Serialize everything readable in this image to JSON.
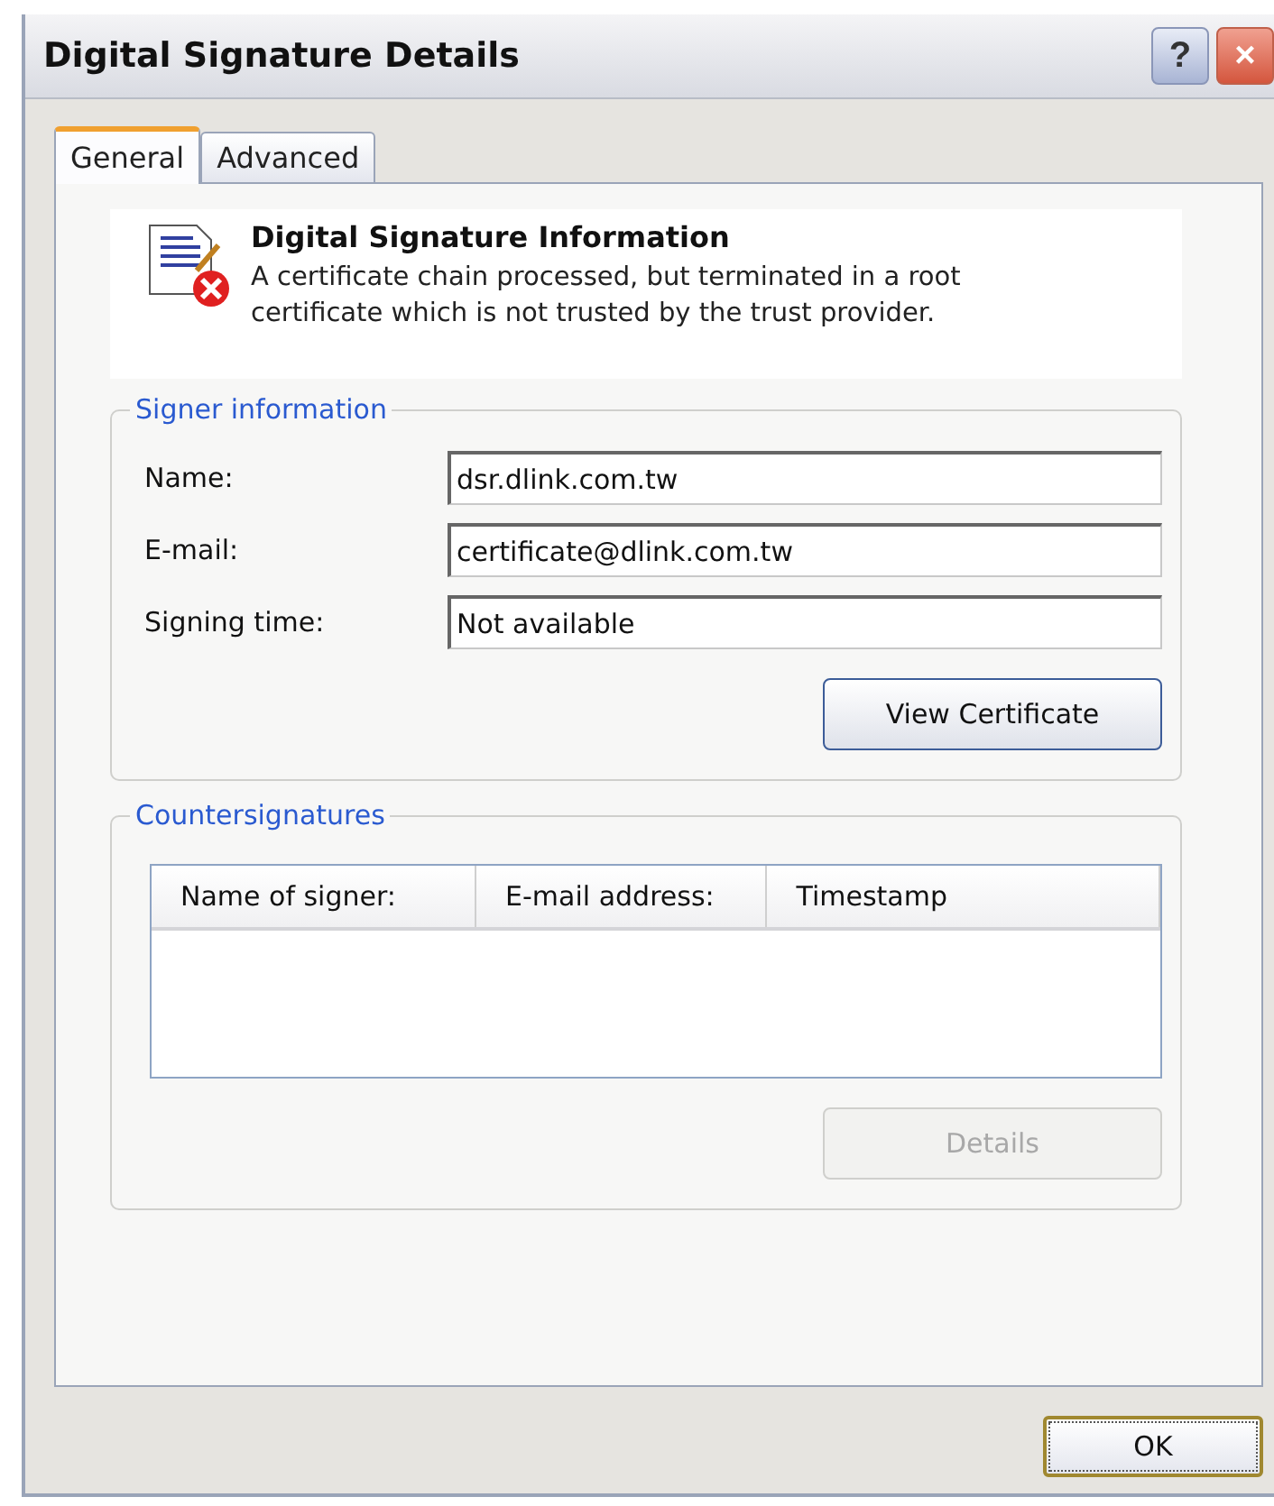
{
  "window": {
    "title": "Digital Signature Details",
    "controls": [
      {
        "kind": "help",
        "label": "?"
      },
      {
        "kind": "close",
        "label": "×"
      }
    ]
  },
  "tabs": [
    {
      "label": "General",
      "selected": true
    },
    {
      "label": "Advanced",
      "selected": false
    }
  ],
  "info": {
    "title": "Digital Signature Information",
    "message": "A certificate chain processed, but terminated in a root certificate which is not trusted by the trust provider."
  },
  "signer": {
    "legend": "Signer information",
    "fields": [
      {
        "label": "Name:",
        "value": "dsr.dlink.com.tw"
      },
      {
        "label": "E-mail:",
        "value": "certificate@dlink.com.tw"
      },
      {
        "label": "Signing time:",
        "value": "Not available"
      }
    ],
    "button": {
      "label": "View Certificate",
      "disabled": false
    }
  },
  "countersignatures": {
    "legend": "Countersignatures",
    "columns": [
      "Name of signer:",
      "E-mail address:",
      "Timestamp"
    ],
    "button": {
      "label": "Details",
      "disabled": true
    }
  },
  "footer": {
    "button": "OK"
  }
}
